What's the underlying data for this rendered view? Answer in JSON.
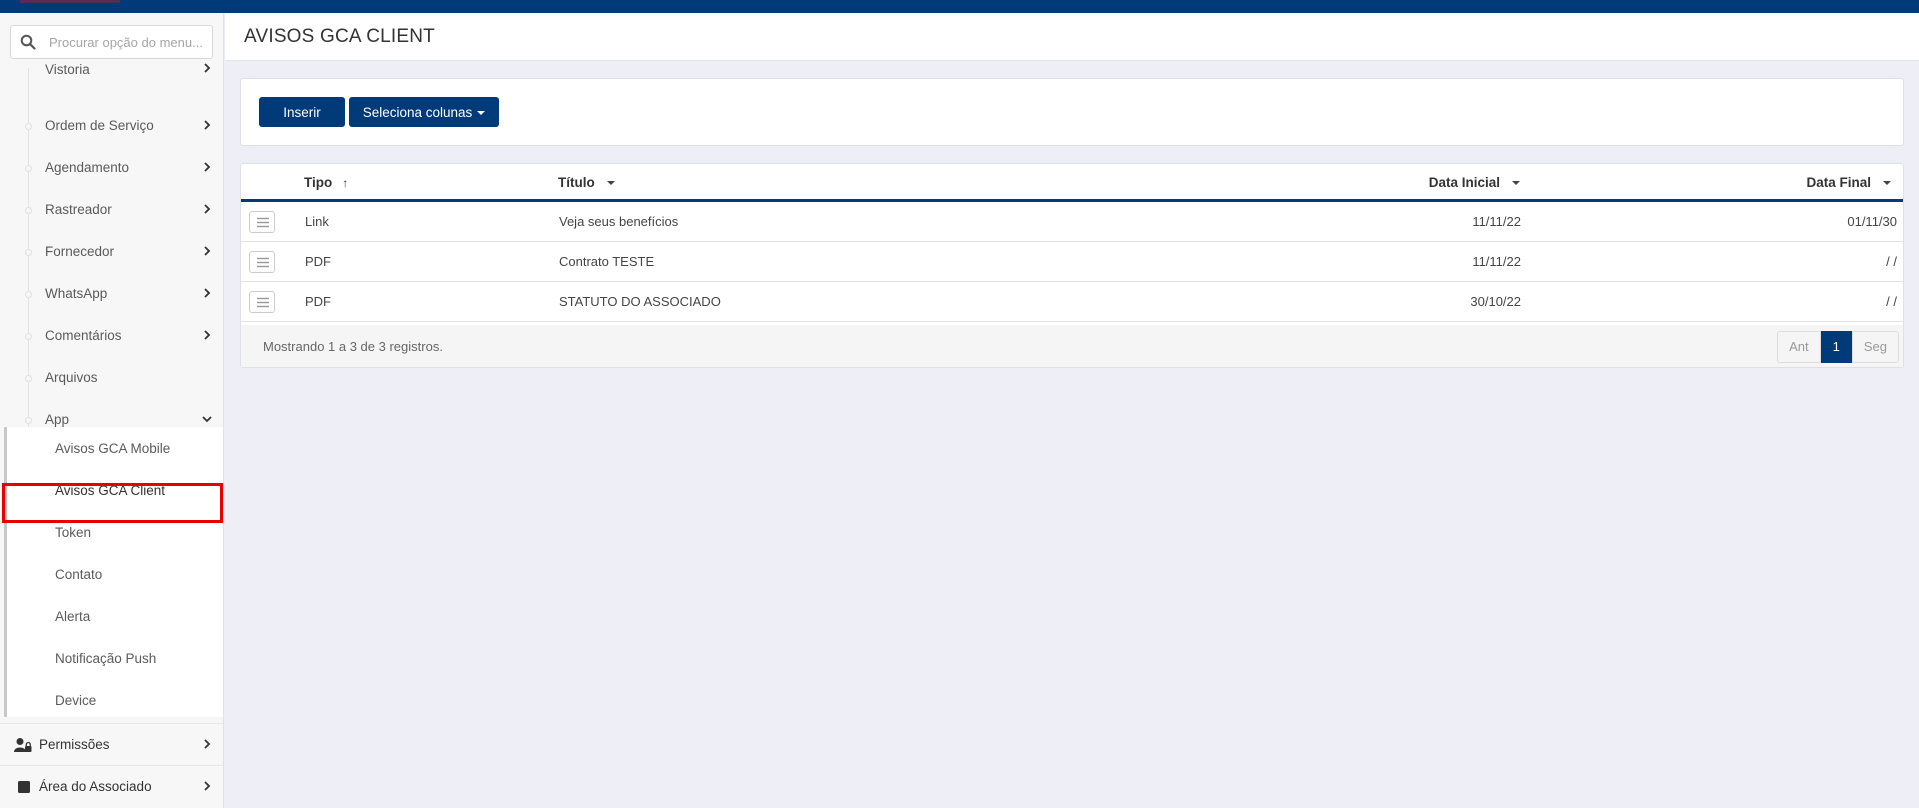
{
  "sidebar": {
    "search_placeholder": "Procurar opção do menu...",
    "items": [
      {
        "label": "Vistoria"
      },
      {
        "label": "Ordem de Serviço"
      },
      {
        "label": "Agendamento"
      },
      {
        "label": "Rastreador"
      },
      {
        "label": "Fornecedor"
      },
      {
        "label": "WhatsApp"
      },
      {
        "label": "Comentários"
      },
      {
        "label": "Arquivos"
      },
      {
        "label": "App"
      }
    ],
    "app_submenu": [
      {
        "label": "Avisos GCA Mobile"
      },
      {
        "label": "Avisos GCA Client"
      },
      {
        "label": "Token"
      },
      {
        "label": "Contato"
      },
      {
        "label": "Alerta"
      },
      {
        "label": "Notificação Push"
      },
      {
        "label": "Device"
      }
    ],
    "sections": [
      {
        "label": "Permissões",
        "icon": "user-lock-icon"
      },
      {
        "label": "Área do Associado",
        "icon": "square-icon"
      }
    ]
  },
  "page": {
    "title": "AVISOS GCA CLIENT"
  },
  "toolbar": {
    "insert_label": "Inserir",
    "columns_label": "Seleciona colunas"
  },
  "grid": {
    "columns": [
      "Tipo",
      "Título",
      "Data Inicial",
      "Data Final"
    ],
    "rows": [
      {
        "tipo": "Link",
        "titulo": "Veja seus benefícios",
        "data_inicial": "11/11/22",
        "data_final": "01/11/30"
      },
      {
        "tipo": "PDF",
        "titulo": "Contrato TESTE",
        "data_inicial": "11/11/22",
        "data_final": "/ /"
      },
      {
        "tipo": "PDF",
        "titulo": "STATUTO DO ASSOCIADO",
        "data_inicial": "30/10/22",
        "data_final": "/ /"
      }
    ],
    "footer_info": "Mostrando 1 a 3 de 3 registros.",
    "pager": {
      "prev": "Ant",
      "current": "1",
      "next": "Seg"
    }
  },
  "colors": {
    "brand": "#003a78",
    "highlight": "#e60000",
    "background": "#edeef6"
  }
}
